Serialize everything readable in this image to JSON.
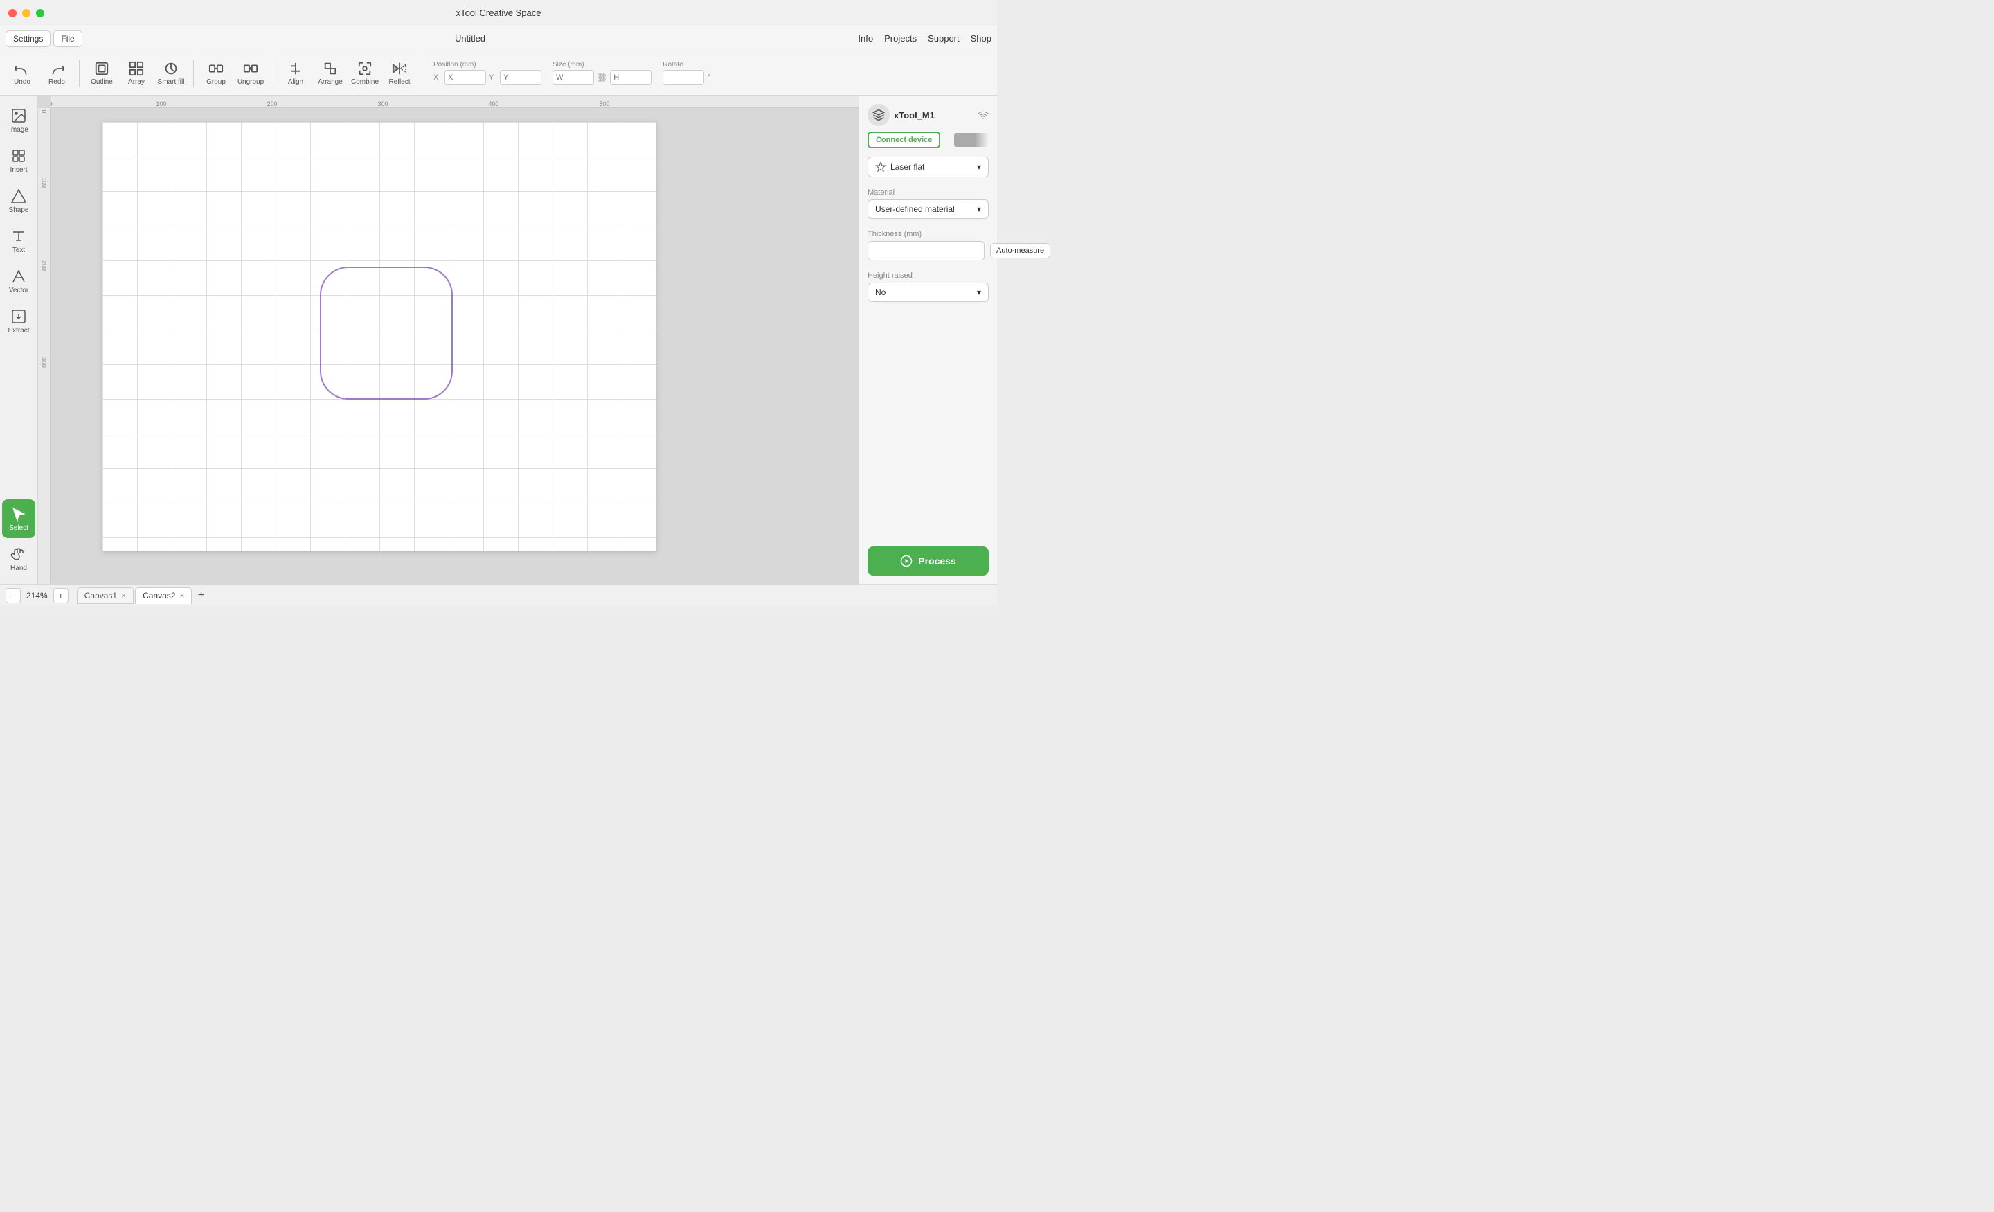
{
  "app": {
    "title": "xTool Creative Space",
    "window_title": "Untitled"
  },
  "traffic_lights": {
    "close": "close",
    "minimize": "minimize",
    "maximize": "maximize"
  },
  "menubar": {
    "settings_label": "Settings",
    "file_label": "File",
    "nav": [
      "Info",
      "Projects",
      "Support",
      "Shop"
    ]
  },
  "toolbar": {
    "undo_label": "Undo",
    "redo_label": "Redo",
    "outline_label": "Outline",
    "array_label": "Array",
    "smart_fill_label": "Smart fill",
    "group_label": "Group",
    "ungroup_label": "Ungroup",
    "align_label": "Align",
    "arrange_label": "Arrange",
    "combine_label": "Combine",
    "reflect_label": "Reflect",
    "position_label": "Position (mm)",
    "x_placeholder": "X",
    "y_placeholder": "Y",
    "size_label": "Size (mm)",
    "w_placeholder": "W",
    "h_placeholder": "H",
    "rotate_label": "Rotate"
  },
  "left_sidebar": {
    "tools": [
      {
        "id": "image",
        "label": "Image"
      },
      {
        "id": "insert",
        "label": "Insert"
      },
      {
        "id": "shape",
        "label": "Shape"
      },
      {
        "id": "text",
        "label": "Text"
      },
      {
        "id": "vector",
        "label": "Vector"
      },
      {
        "id": "extract",
        "label": "Extract"
      },
      {
        "id": "select",
        "label": "Select"
      },
      {
        "id": "hand",
        "label": "Hand"
      }
    ]
  },
  "canvas": {
    "zoom_percent": "214%",
    "zoom_minus": "−",
    "zoom_plus": "+",
    "ruler_marks": [
      "0",
      "100",
      "200",
      "300",
      "400",
      "500"
    ],
    "ruler_marks_v": [
      "0",
      "100",
      "200",
      "300"
    ]
  },
  "tabs": [
    {
      "id": "canvas1",
      "label": "Canvas1",
      "active": false
    },
    {
      "id": "canvas2",
      "label": "Canvas2",
      "active": true
    }
  ],
  "right_sidebar": {
    "device_name": "xTool_M1",
    "connect_label": "Connect device",
    "laser_type": "Laser flat",
    "material_label": "Material",
    "material_value": "User-defined material",
    "thickness_label": "Thickness (mm)",
    "auto_measure_label": "Auto-measure",
    "height_raised_label": "Height raised",
    "height_raised_value": "No",
    "process_label": "Process"
  },
  "colors": {
    "accent_green": "#4caf50",
    "shape_stroke": "#9c7cc7",
    "active_tool_bg": "#4caf50"
  }
}
